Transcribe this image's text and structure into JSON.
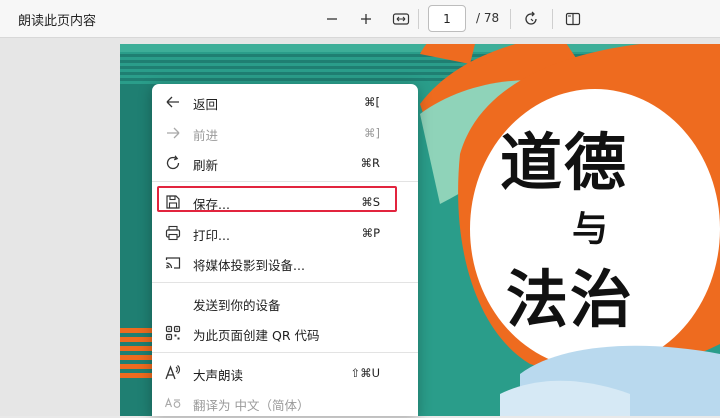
{
  "toolbar": {
    "title": "朗读此页内容",
    "zoom_out_icon": "minus-icon",
    "zoom_in_icon": "plus-icon",
    "fit_icon": "fit-width-icon",
    "page_current": "1",
    "page_total": "/ 78",
    "rotate_icon": "rotate-icon",
    "two_page_icon": "two-page-view-icon"
  },
  "cover": {
    "line1": "道德",
    "line2": "与",
    "line3": "法治",
    "colors": {
      "teal": "#2a9d8a",
      "dark_teal": "#1f7f72",
      "orange": "#ee6b1f",
      "mint": "#8fd3b9",
      "sky": "#b9d9ee"
    }
  },
  "menu": {
    "items": [
      {
        "label": "返回",
        "shortcut": "⌘[",
        "icon": "back-arrow-icon",
        "disabled": false
      },
      {
        "label": "前进",
        "shortcut": "⌘]",
        "icon": "forward-arrow-icon",
        "disabled": true
      },
      {
        "label": "刷新",
        "shortcut": "⌘R",
        "icon": "refresh-icon",
        "disabled": false
      },
      {
        "label": "保存...",
        "shortcut": "⌘S",
        "icon": "save-icon",
        "disabled": false
      },
      {
        "label": "打印...",
        "shortcut": "⌘P",
        "icon": "print-icon",
        "disabled": false
      },
      {
        "label": "将媒体投影到设备...",
        "shortcut": "",
        "icon": "cast-icon",
        "disabled": false
      },
      {
        "label": "发送到你的设备",
        "shortcut": "",
        "icon": "",
        "disabled": false
      },
      {
        "label": "为此页面创建 QR 代码",
        "shortcut": "",
        "icon": "qr-code-icon",
        "disabled": false
      },
      {
        "label": "大声朗读",
        "shortcut": "⇧⌘U",
        "icon": "read-aloud-icon",
        "disabled": false
      },
      {
        "label": "翻译为 中文（简体）",
        "shortcut": "",
        "icon": "translate-icon",
        "disabled": true
      }
    ],
    "highlight_color": "#e2243e"
  }
}
